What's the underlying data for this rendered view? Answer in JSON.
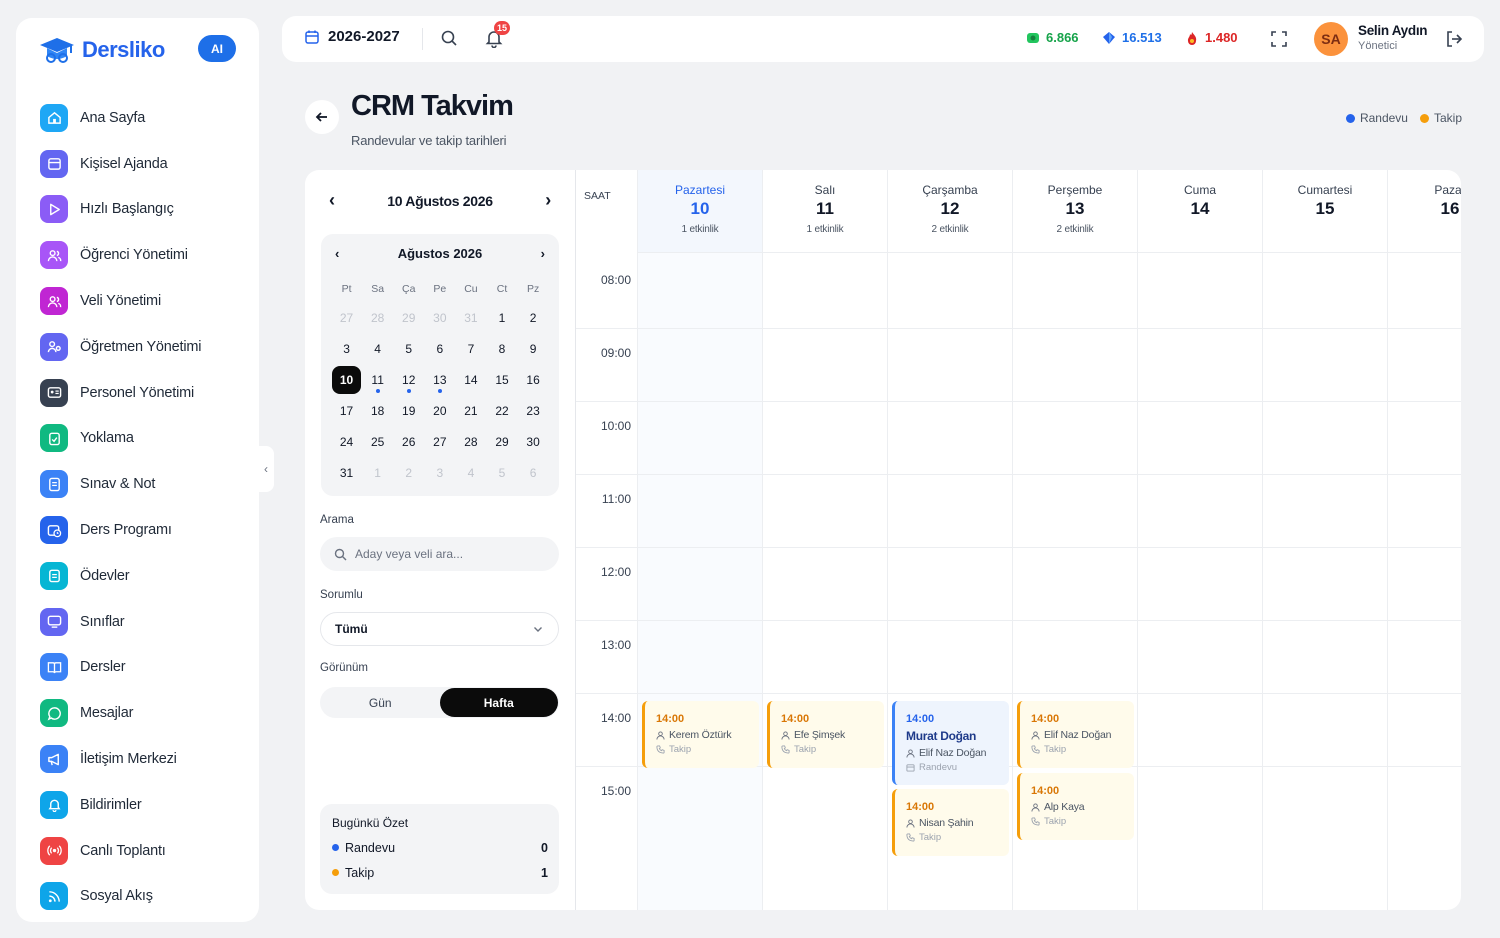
{
  "app": {
    "name": "Dersliko",
    "ai_label": "AI"
  },
  "sidebar": {
    "items": [
      {
        "label": "Ana Sayfa",
        "icon": "home-icon",
        "color": "#1ea7f5"
      },
      {
        "label": "Kişisel Ajanda",
        "icon": "calendar-icon",
        "color": "#6366f1"
      },
      {
        "label": "Hızlı Başlangıç",
        "icon": "play-icon",
        "color": "#8b5cf6"
      },
      {
        "label": "Öğrenci Yönetimi",
        "icon": "users-icon",
        "color": "#a855f7"
      },
      {
        "label": "Veli Yönetimi",
        "icon": "users-icon",
        "color": "#c026d3"
      },
      {
        "label": "Öğretmen Yönetimi",
        "icon": "teacher-icon",
        "color": "#6366f1"
      },
      {
        "label": "Personel Yönetimi",
        "icon": "id-card-icon",
        "color": "#374151"
      },
      {
        "label": "Yoklama",
        "icon": "clipboard-check-icon",
        "color": "#10b981"
      },
      {
        "label": "Sınav & Not",
        "icon": "document-icon",
        "color": "#3b82f6"
      },
      {
        "label": "Ders Programı",
        "icon": "calendar-clock-icon",
        "color": "#2563eb"
      },
      {
        "label": "Ödevler",
        "icon": "clipboard-icon",
        "color": "#06b6d4"
      },
      {
        "label": "Sınıflar",
        "icon": "monitor-icon",
        "color": "#6366f1"
      },
      {
        "label": "Dersler",
        "icon": "book-icon",
        "color": "#3b82f6"
      },
      {
        "label": "Mesajlar",
        "icon": "chat-icon",
        "color": "#10b981"
      },
      {
        "label": "İletişim Merkezi",
        "icon": "megaphone-icon",
        "color": "#3b82f6"
      },
      {
        "label": "Bildirimler",
        "icon": "bell-icon",
        "color": "#0ea5e9"
      },
      {
        "label": "Canlı Toplantı",
        "icon": "broadcast-icon",
        "color": "#ef4444"
      },
      {
        "label": "Sosyal Akış",
        "icon": "rss-icon",
        "color": "#0ea5e9"
      }
    ]
  },
  "topbar": {
    "year": "2026-2027",
    "notif_count": "15",
    "stats": [
      {
        "value": "6.866",
        "color": "#16a34a",
        "icon": "money-icon"
      },
      {
        "value": "16.513",
        "color": "#1e6fe8",
        "icon": "diamond-icon"
      },
      {
        "value": "1.480",
        "color": "#dc2626",
        "icon": "fire-icon"
      }
    ],
    "user": {
      "initials": "SA",
      "name": "Selin Aydın",
      "role": "Yönetici"
    }
  },
  "page": {
    "title": "CRM Takvim",
    "subtitle": "Randevular ve takip tarihleri",
    "legend": [
      {
        "label": "Randevu",
        "color": "#2563eb"
      },
      {
        "label": "Takip",
        "color": "#f59e0b"
      }
    ]
  },
  "left_panel": {
    "week_label": "10 Ağustos 2026",
    "mini_calendar": {
      "month_label": "Ağustos 2026",
      "dow": [
        "Pt",
        "Sa",
        "Ça",
        "Pe",
        "Cu",
        "Ct",
        "Pz"
      ],
      "days": [
        {
          "d": "27",
          "other": true
        },
        {
          "d": "28",
          "other": true
        },
        {
          "d": "29",
          "other": true
        },
        {
          "d": "30",
          "other": true
        },
        {
          "d": "31",
          "other": true
        },
        {
          "d": "1"
        },
        {
          "d": "2"
        },
        {
          "d": "3"
        },
        {
          "d": "4"
        },
        {
          "d": "5"
        },
        {
          "d": "6"
        },
        {
          "d": "7"
        },
        {
          "d": "8"
        },
        {
          "d": "9"
        },
        {
          "d": "10",
          "selected": true
        },
        {
          "d": "11",
          "dot": true
        },
        {
          "d": "12",
          "dot": true
        },
        {
          "d": "13",
          "dot": true
        },
        {
          "d": "14"
        },
        {
          "d": "15"
        },
        {
          "d": "16"
        },
        {
          "d": "17"
        },
        {
          "d": "18"
        },
        {
          "d": "19"
        },
        {
          "d": "20"
        },
        {
          "d": "21"
        },
        {
          "d": "22"
        },
        {
          "d": "23"
        },
        {
          "d": "24"
        },
        {
          "d": "25"
        },
        {
          "d": "26"
        },
        {
          "d": "27"
        },
        {
          "d": "28"
        },
        {
          "d": "29"
        },
        {
          "d": "30"
        },
        {
          "d": "31"
        },
        {
          "d": "1",
          "other": true
        },
        {
          "d": "2",
          "other": true
        },
        {
          "d": "3",
          "other": true
        },
        {
          "d": "4",
          "other": true
        },
        {
          "d": "5",
          "other": true
        },
        {
          "d": "6",
          "other": true
        }
      ]
    },
    "search_label": "Arama",
    "search_placeholder": "Aday veya veli ara...",
    "responsible_label": "Sorumlu",
    "responsible_value": "Tümü",
    "view_label": "Görünüm",
    "view_options": [
      "Gün",
      "Hafta"
    ],
    "view_selected": "Hafta",
    "summary": {
      "title": "Bugünkü Özet",
      "rows": [
        {
          "label": "Randevu",
          "value": "0",
          "color": "#2563eb"
        },
        {
          "label": "Takip",
          "value": "1",
          "color": "#f59e0b"
        }
      ]
    }
  },
  "calendar": {
    "time_header": "SAAT",
    "hours": [
      "08:00",
      "09:00",
      "10:00",
      "11:00",
      "12:00",
      "13:00",
      "14:00",
      "15:00"
    ],
    "days": [
      {
        "name": "Pazartesi",
        "num": "10",
        "count": "1 etkinlik",
        "today": true
      },
      {
        "name": "Salı",
        "num": "11",
        "count": "1 etkinlik"
      },
      {
        "name": "Çarşamba",
        "num": "12",
        "count": "2 etkinlik"
      },
      {
        "name": "Perşembe",
        "num": "13",
        "count": "2 etkinlik"
      },
      {
        "name": "Cuma",
        "num": "14",
        "count": ""
      },
      {
        "name": "Cumartesi",
        "num": "15",
        "count": ""
      },
      {
        "name": "Pazar",
        "num": "16",
        "count": ""
      }
    ],
    "events": [
      {
        "day": 0,
        "slot": 0,
        "kind": "takip",
        "time": "14:00",
        "title": "",
        "person": "Kerem Öztürk",
        "type": "Takip"
      },
      {
        "day": 1,
        "slot": 0,
        "kind": "takip",
        "time": "14:00",
        "title": "",
        "person": "Efe Şimşek",
        "type": "Takip"
      },
      {
        "day": 2,
        "slot": 0,
        "kind": "randevu",
        "time": "14:00",
        "title": "Murat Doğan",
        "person": "Elif Naz Doğan",
        "type": "Randevu"
      },
      {
        "day": 2,
        "slot": 1,
        "kind": "takip",
        "time": "14:00",
        "title": "",
        "person": "Nisan Şahin",
        "type": "Takip"
      },
      {
        "day": 3,
        "slot": 0,
        "kind": "takip",
        "time": "14:00",
        "title": "",
        "person": "Elif Naz Doğan",
        "type": "Takip"
      },
      {
        "day": 3,
        "slot": 1,
        "kind": "takip",
        "time": "14:00",
        "title": "",
        "person": "Alp Kaya",
        "type": "Takip"
      }
    ]
  }
}
